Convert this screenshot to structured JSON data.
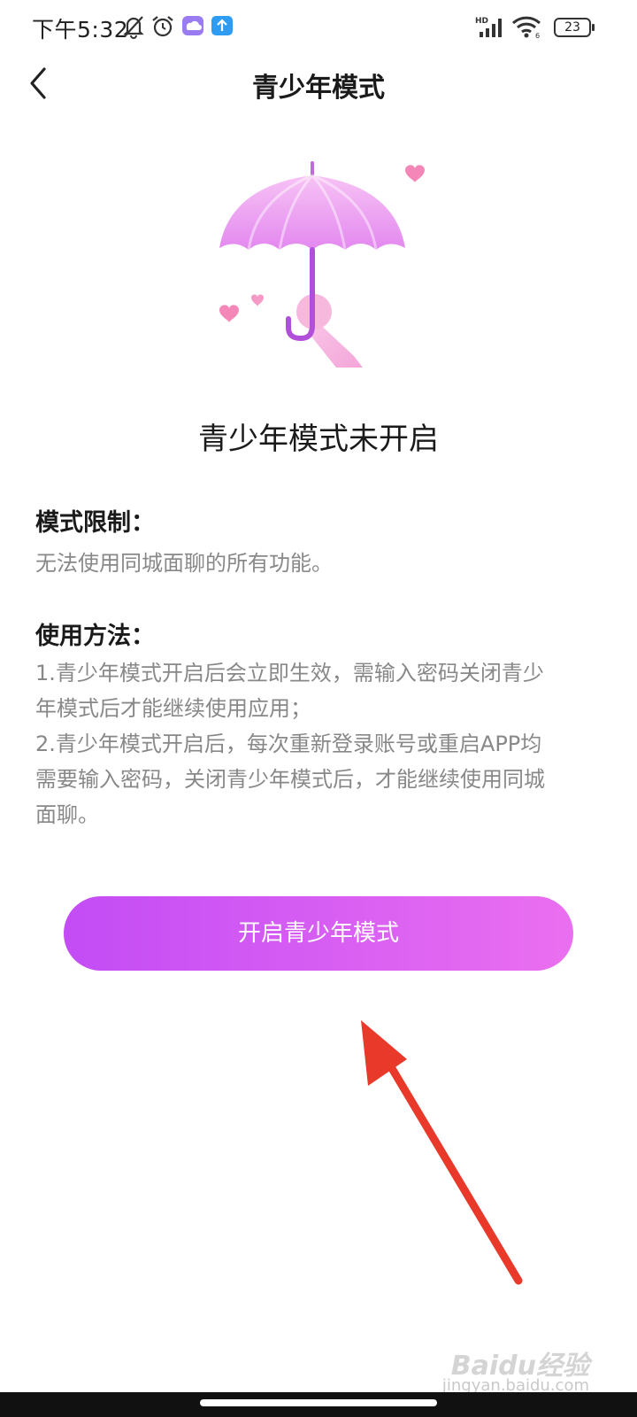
{
  "status_bar": {
    "time": "下午5:32",
    "battery": "23",
    "icons": [
      "mute-bell-icon",
      "alarm-icon",
      "app-notification-icon",
      "upload-notification-icon",
      "hd-signal-icon",
      "wifi-icon",
      "battery-icon"
    ]
  },
  "header": {
    "title": "青少年模式",
    "back_icon": "chevron-left-icon"
  },
  "illustration": {
    "icon": "umbrella-with-hearts-illustration",
    "colors": {
      "umbrella": "#f0a6f2",
      "handle": "#b14fdb",
      "heart": "#f487b8"
    }
  },
  "main": {
    "status_heading": "青少年模式未开启",
    "restriction": {
      "title": "模式限制：",
      "text": "无法使用同城面聊的所有功能。"
    },
    "usage": {
      "title": "使用方法：",
      "lines": [
        "1.青少年模式开启后会立即生效，需输入密码关闭青少",
        "年模式后才能继续使用应用；",
        "2.青少年模式开启后，每次重新登录账号或重启APP均",
        "需要输入密码，关闭青少年模式后，才能继续使用同城",
        "面聊。"
      ]
    },
    "enable_button": "开启青少年模式"
  },
  "theme": {
    "button_gradient_start": "#c34cf5",
    "button_gradient_end": "#ea6ff0",
    "annotation_arrow": "#e8392a"
  },
  "watermark": {
    "brand": "Baidu经验",
    "url": "jingyan.baidu.com"
  }
}
